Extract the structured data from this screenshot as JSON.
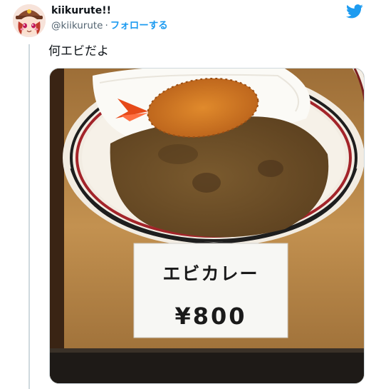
{
  "tweet": {
    "display_name": "kiikurute!!",
    "handle": "@kiikurute",
    "separator": "·",
    "follow_label": "フォローする",
    "text": "何エビだよ"
  },
  "photo": {
    "sign_name": "エビカレー",
    "sign_price": "¥800"
  },
  "colors": {
    "accent": "#1d9bf0",
    "text": "#0f1419",
    "secondary": "#536471"
  },
  "icons": [
    "twitter-bird-icon",
    "avatar"
  ]
}
